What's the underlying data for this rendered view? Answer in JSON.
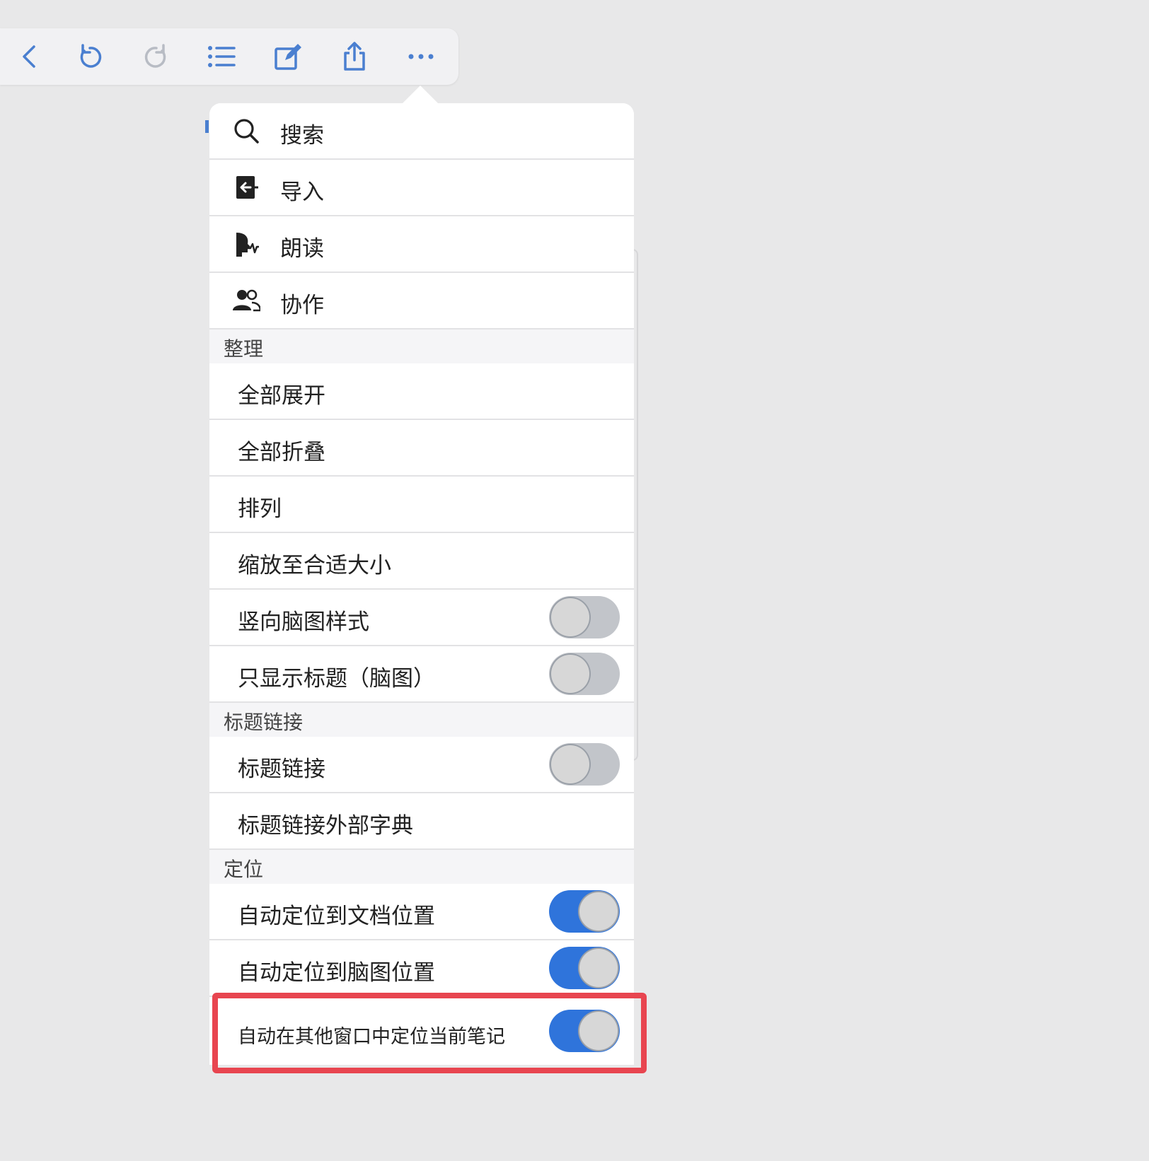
{
  "toolbar": {
    "buttons": [
      {
        "icon": "back-chevron-icon"
      },
      {
        "icon": "undo-icon"
      },
      {
        "icon": "redo-icon"
      },
      {
        "icon": "list-icon"
      },
      {
        "icon": "edit-icon"
      },
      {
        "icon": "share-icon"
      },
      {
        "icon": "more-icon"
      }
    ],
    "accent_color": "#4a7fd0",
    "disabled_color": "#b8bcc4"
  },
  "menu": {
    "top_items": [
      {
        "label": "搜索",
        "icon": "search-icon"
      },
      {
        "label": "导入",
        "icon": "import-icon"
      },
      {
        "label": "朗读",
        "icon": "read-aloud-icon"
      },
      {
        "label": "协作",
        "icon": "people-icon"
      }
    ],
    "sections": {
      "organize": {
        "title": "整理",
        "items": [
          {
            "label": "全部展开"
          },
          {
            "label": "全部折叠"
          },
          {
            "label": "排列"
          },
          {
            "label": "缩放至合适大小"
          },
          {
            "label": "竖向脑图样式",
            "toggle": false
          },
          {
            "label": "只显示标题（脑图）",
            "toggle": false
          }
        ]
      },
      "title_link": {
        "title": "标题链接",
        "items": [
          {
            "label": "标题链接",
            "toggle": false
          },
          {
            "label": "标题链接外部字典"
          }
        ]
      },
      "locate": {
        "title": "定位",
        "items": [
          {
            "label": "自动定位到文档位置",
            "toggle": true
          },
          {
            "label": "自动定位到脑图位置",
            "toggle": true
          },
          {
            "label": "自动在其他窗口中定位当前笔记",
            "toggle": true
          }
        ]
      }
    }
  },
  "colors": {
    "toggle_on": "#2f74db",
    "toggle_off": "#c2c5ca",
    "highlight_border": "#e84550",
    "background": "#e8e8e9"
  }
}
